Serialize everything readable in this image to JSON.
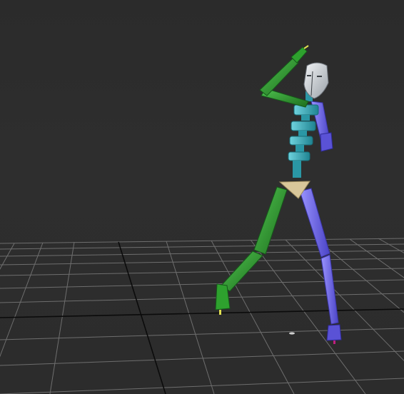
{
  "viewport": {
    "label": "",
    "background_color": "#2c2c2c",
    "grid_color": "#6e6e6e",
    "axis_color": "#0b0b0b"
  },
  "biped": {
    "head_color": "#d8dde2",
    "spine_color": "#3fb3c0",
    "left_side_color": "#2e9a2e",
    "right_side_color": "#6b64e0",
    "pelvis_color": "#d9c79a",
    "toe_marker_color": "#e0e050"
  }
}
